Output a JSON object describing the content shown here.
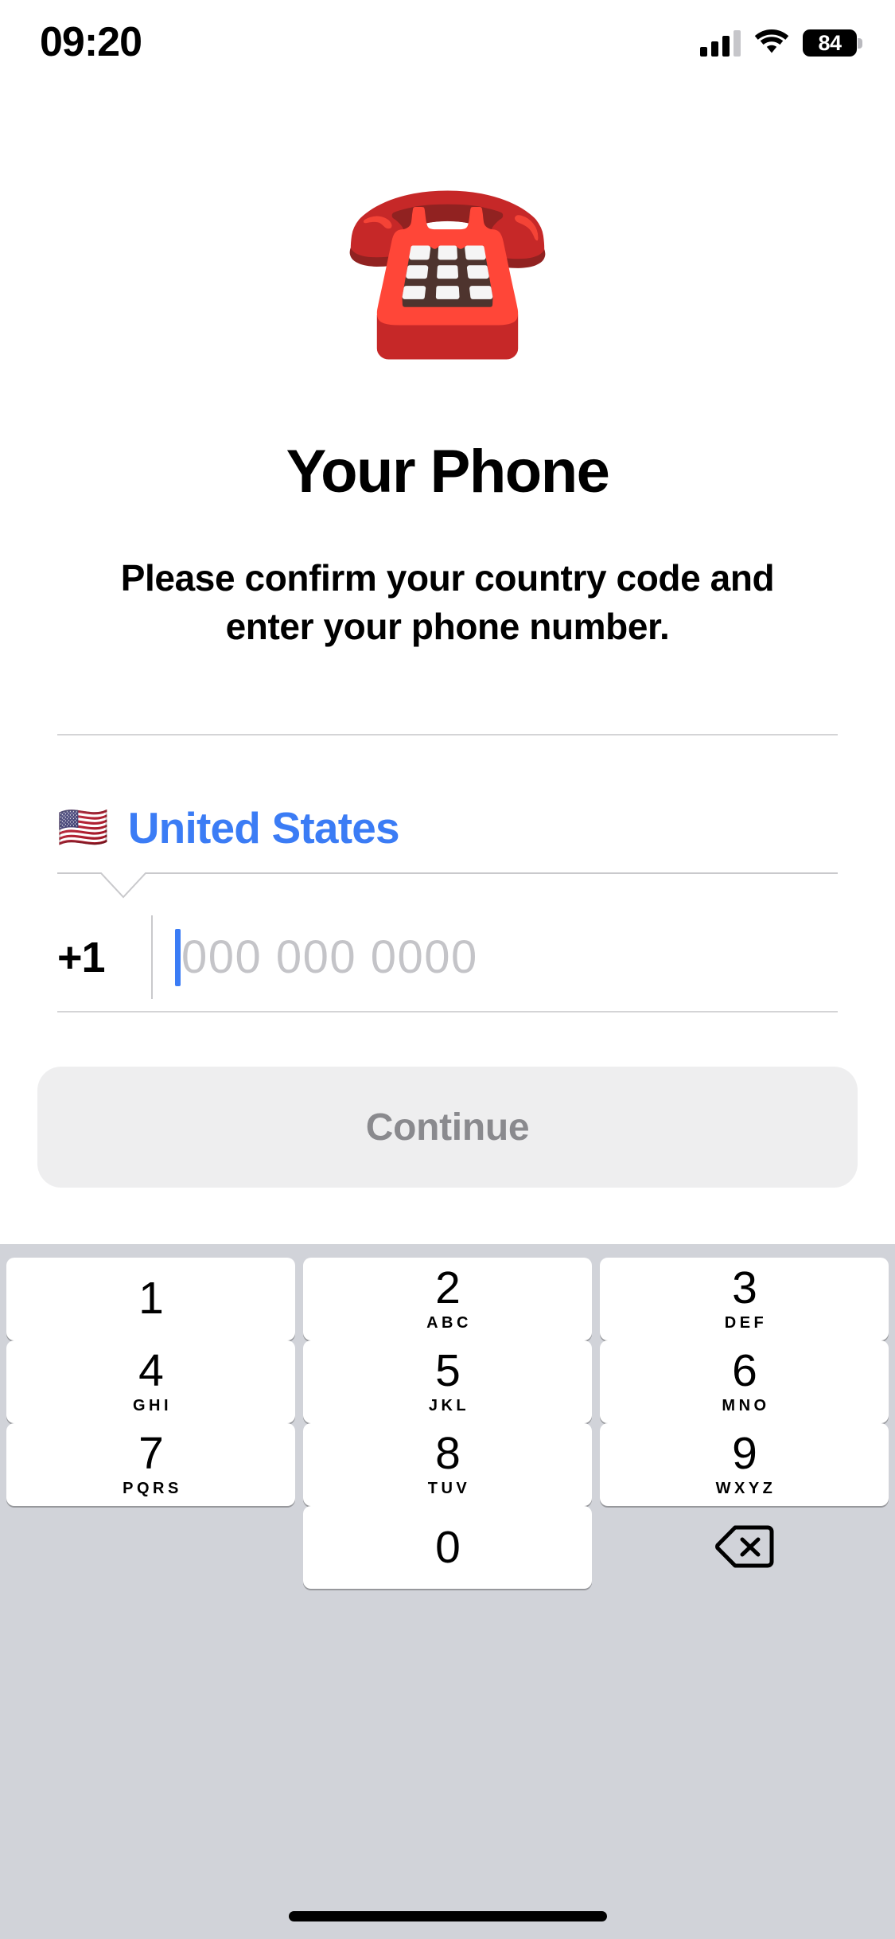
{
  "status_bar": {
    "time": "09:20",
    "battery_level": "84",
    "cellular_icon": "cellular-signal-icon",
    "wifi_icon": "wifi-icon",
    "battery_icon": "battery-icon"
  },
  "hero": {
    "emoji": "☎️",
    "icon_name": "telephone-emoji"
  },
  "header": {
    "title": "Your Phone",
    "subtitle": "Please confirm your country code and enter your phone number."
  },
  "form": {
    "country": {
      "flag": "🇺🇸",
      "name": "United States"
    },
    "dial_code": "+1",
    "phone_placeholder": "000 000 0000",
    "phone_value": "",
    "submit_label": "Continue"
  },
  "keypad": {
    "keys": [
      {
        "digit": "1",
        "letters": ""
      },
      {
        "digit": "2",
        "letters": "ABC"
      },
      {
        "digit": "3",
        "letters": "DEF"
      },
      {
        "digit": "4",
        "letters": "GHI"
      },
      {
        "digit": "5",
        "letters": "JKL"
      },
      {
        "digit": "6",
        "letters": "MNO"
      },
      {
        "digit": "7",
        "letters": "PQRS"
      },
      {
        "digit": "8",
        "letters": "TUV"
      },
      {
        "digit": "9",
        "letters": "WXYZ"
      },
      {
        "digit": "0",
        "letters": ""
      }
    ],
    "delete_icon": "backspace-delete-icon"
  },
  "colors": {
    "accent_blue": "#3b7cf5",
    "keyboard_background": "#d1d3d9",
    "key_white": "#ffffff",
    "button_disabled_bg": "#eeeeef",
    "button_disabled_text": "#8a8a8e",
    "placeholder_gray": "#c4c4c8",
    "divider_gray": "#d4d4d6"
  }
}
